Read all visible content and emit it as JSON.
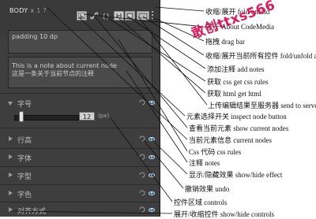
{
  "panel": {
    "title": "BODY",
    "title_x": "x",
    "title_n": "1",
    "title_mark": "?",
    "padding_text": "padding 10 dp",
    "note_text_1": "This is a note about current node",
    "note_text_2": "这是一条关于当前节点的注释",
    "sections": [
      {
        "label": "字号",
        "expanded": true
      },
      {
        "label": "行高",
        "expanded": false
      },
      {
        "label": "字体",
        "expanded": false
      },
      {
        "label": "字型",
        "expanded": false
      },
      {
        "label": "字色",
        "expanded": false
      },
      {
        "label": "对齐方式",
        "expanded": false
      }
    ],
    "font_size_value": "12",
    "font_size_unit": "(px)",
    "font_size_level": 0.08
  },
  "callouts": [
    "收缩/展开 fold/unfold",
    "关于 About CodeMedia",
    "拖拽 drag bar",
    "收缩/展开当前所有控件 fold/unfold all",
    "添加注释 add notes",
    "获取 css  get css rules",
    "获取 html  get html",
    "上传编辑结果至服务器 send to server",
    "元素选择开关 inspect node button",
    "查看当前元素 show current nodes",
    "当前元素信息 current nodes",
    "Css 代码 css rules",
    "注释 notes",
    "显示/隐藏效果 show/hide effect",
    "撤销效果 undo",
    "控件区域 controls",
    "展开/收缩控件 show/hide controls"
  ],
  "watermark": "敢创ttxs566",
  "colors": {
    "panel_bg": "#3e3e3e",
    "watermark": "#e0195a",
    "eye": "#bfe6ff"
  }
}
